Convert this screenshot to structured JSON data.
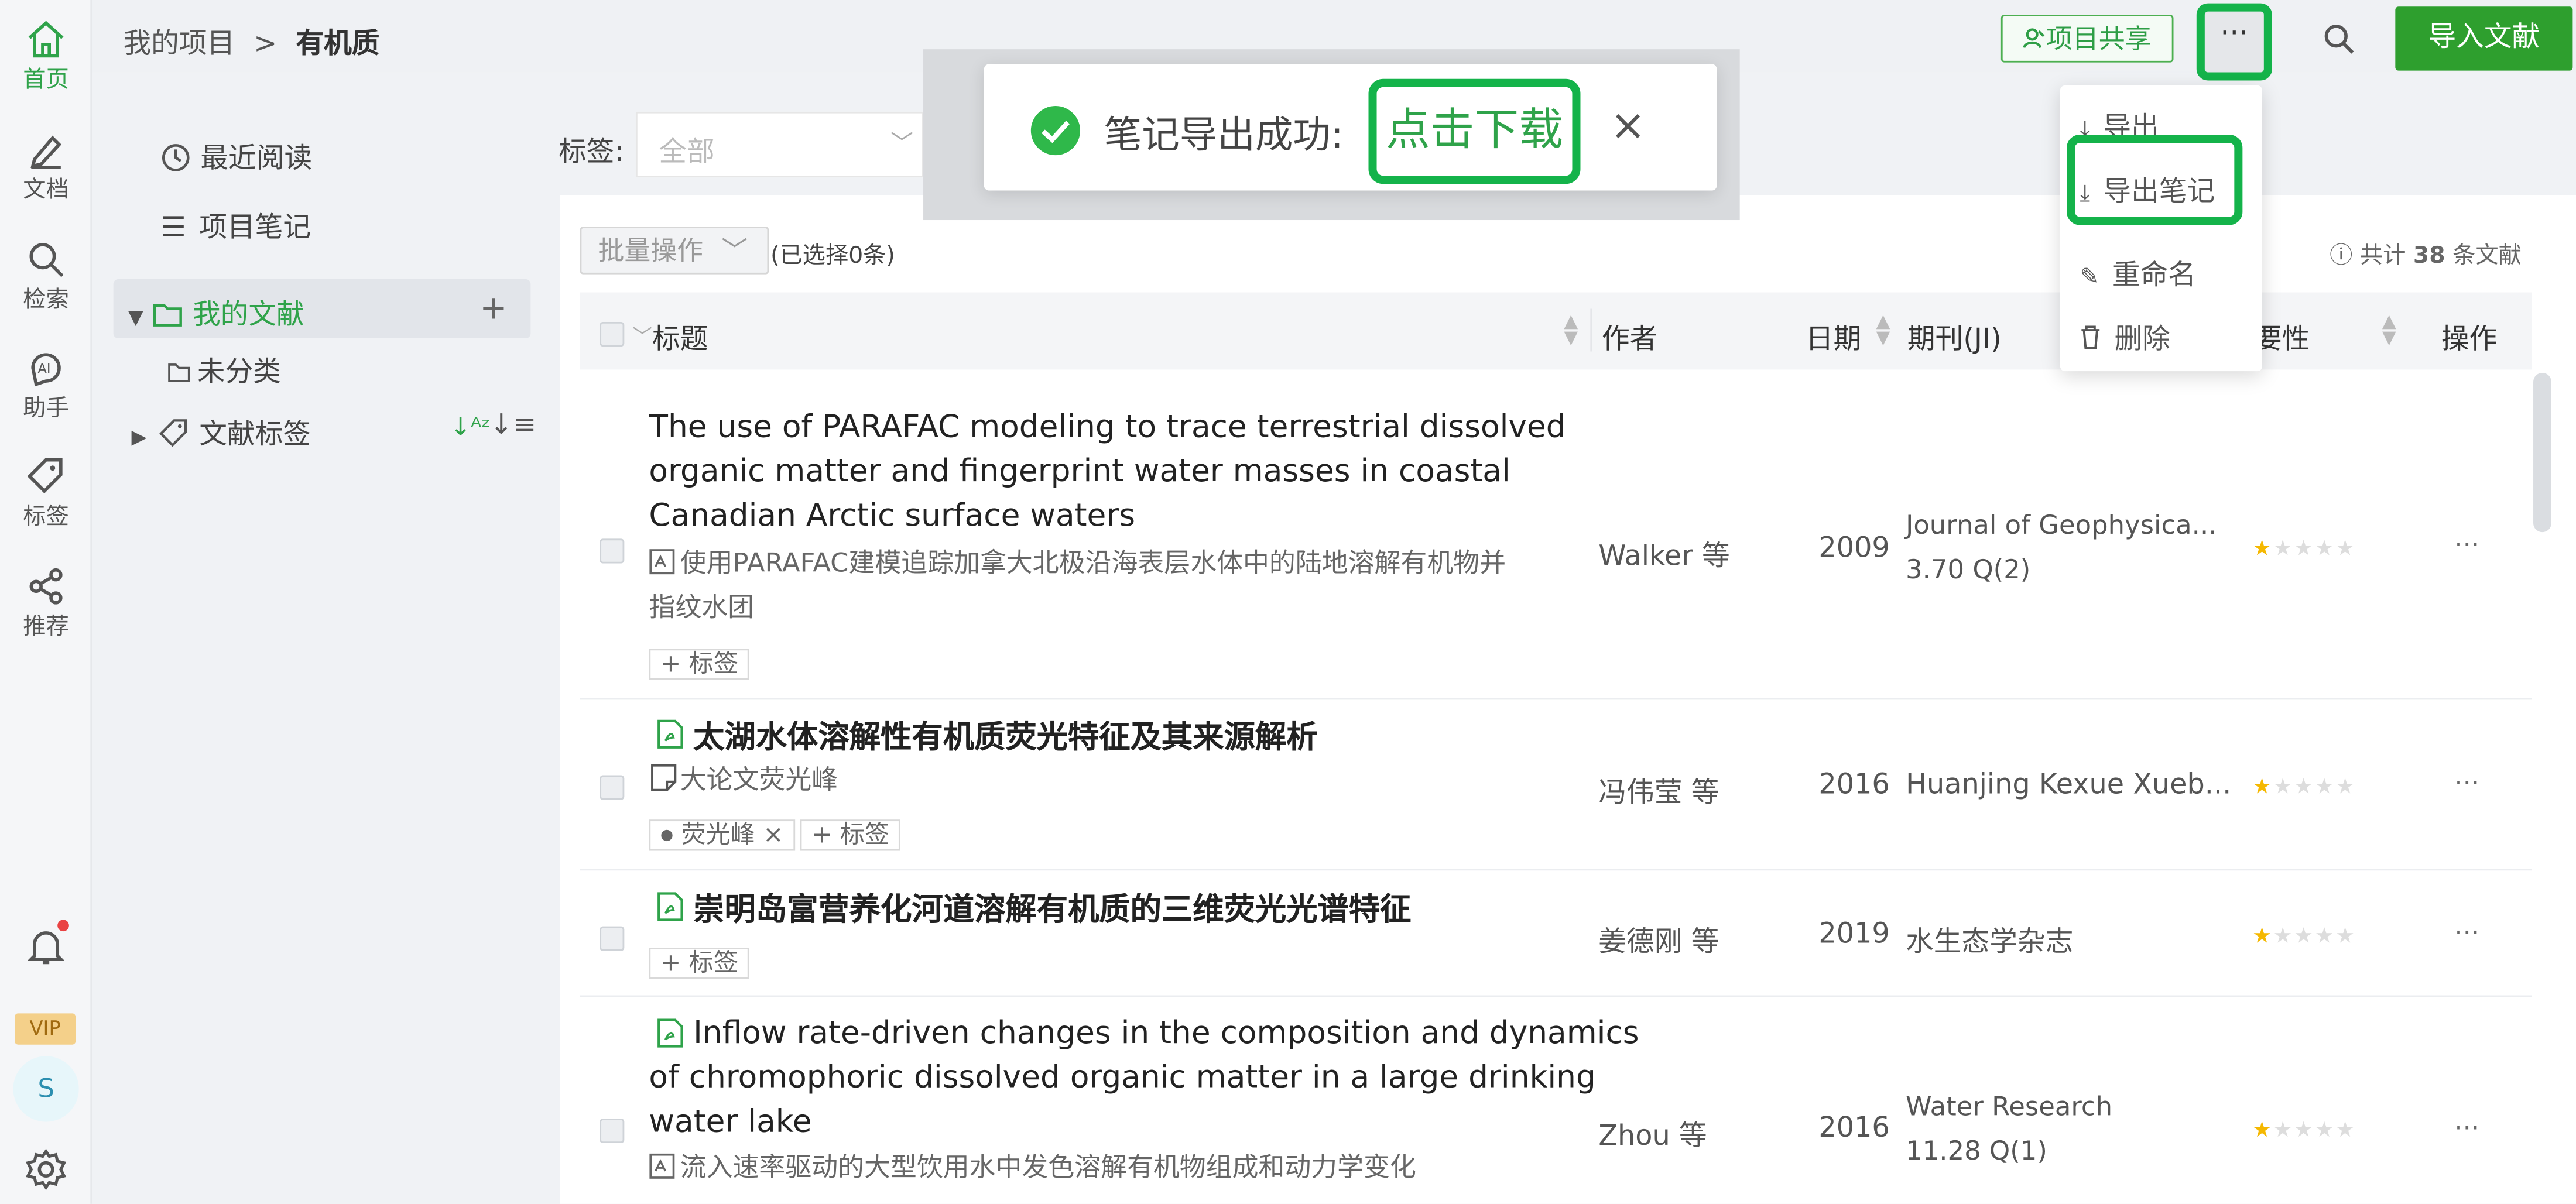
{
  "rail": {
    "home": "首页",
    "docs": "文档",
    "search": "检索",
    "assistant": "助手",
    "tags": "标签",
    "recommend": "推荐",
    "vip": "VIP",
    "avatar": "S"
  },
  "topbar": {
    "crumb_root": "我的项目",
    "crumb_sep": ">",
    "crumb_current": "有机质",
    "share": "项目共享",
    "more": "···",
    "import": "导入文献"
  },
  "sidebar": {
    "recent": "最近阅读",
    "notes": "项目笔记",
    "my_docs": "我的文献",
    "uncategorized": "未分类",
    "doc_tags": "文献标签"
  },
  "filter": {
    "tag_label": "标签:",
    "tag_value": "全部"
  },
  "toolbar": {
    "batch": "批量操作",
    "selected": "(已选择0条)",
    "total_prefix": "共计",
    "total_count": "38",
    "total_suffix": "条文献"
  },
  "table": {
    "headers": {
      "title": "标题",
      "author": "作者",
      "date": "日期",
      "journal": "期刊(JI)",
      "relevance": "要性",
      "action": "操作"
    },
    "rows": [
      {
        "title_lines": [
          "The use of PARAFAC modeling to trace terrestrial dissolved",
          "organic matter and fingerprint water masses in coastal",
          "Canadian Arctic surface waters"
        ],
        "sub_lines": [
          "使用PARAFAC建模追踪加拿大北极沿海表层水体中的陆地溶解有机物并",
          "指纹水团"
        ],
        "tags": [],
        "add_tag": "标签",
        "author": "Walker 等",
        "year": "2009",
        "journal": "Journal of Geophysica...",
        "journal_metric": "3.70 Q(2)",
        "rating": 1
      },
      {
        "title": "太湖水体溶解性有机质荧光特征及其来源解析",
        "note": "大论文荧光峰",
        "tags": [
          "荧光峰"
        ],
        "add_tag": "标签",
        "author": "冯伟莹 等",
        "year": "2016",
        "journal": "Huanjing Kexue Xueb...",
        "rating": 1
      },
      {
        "title": "崇明岛富营养化河道溶解有机质的三维荧光光谱特征",
        "add_tag": "标签",
        "author": "姜德刚 等",
        "year": "2019",
        "journal": "水生态学杂志",
        "rating": 1
      },
      {
        "title_lines": [
          "Inflow rate-driven changes in the composition and dynamics",
          "of chromophoric dissolved organic matter in a large drinking",
          "water lake"
        ],
        "sub_lines": [
          "流入速率驱动的大型饮用水中发色溶解有机物组成和动力学变化"
        ],
        "author": "Zhou 等",
        "year": "2016",
        "journal": "Water Research",
        "journal_metric": "11.28 Q(1)",
        "rating": 1
      }
    ]
  },
  "toast": {
    "message": "笔记导出成功:",
    "link": "点击下载",
    "close": "×"
  },
  "menu": {
    "export": "导出",
    "export_notes": "导出笔记",
    "rename": "重命名",
    "delete": "删除"
  },
  "colors": {
    "brand": "#2fa34a",
    "highlight": "#14b34a",
    "import": "#2e9f2e",
    "star": "#f5b800"
  }
}
